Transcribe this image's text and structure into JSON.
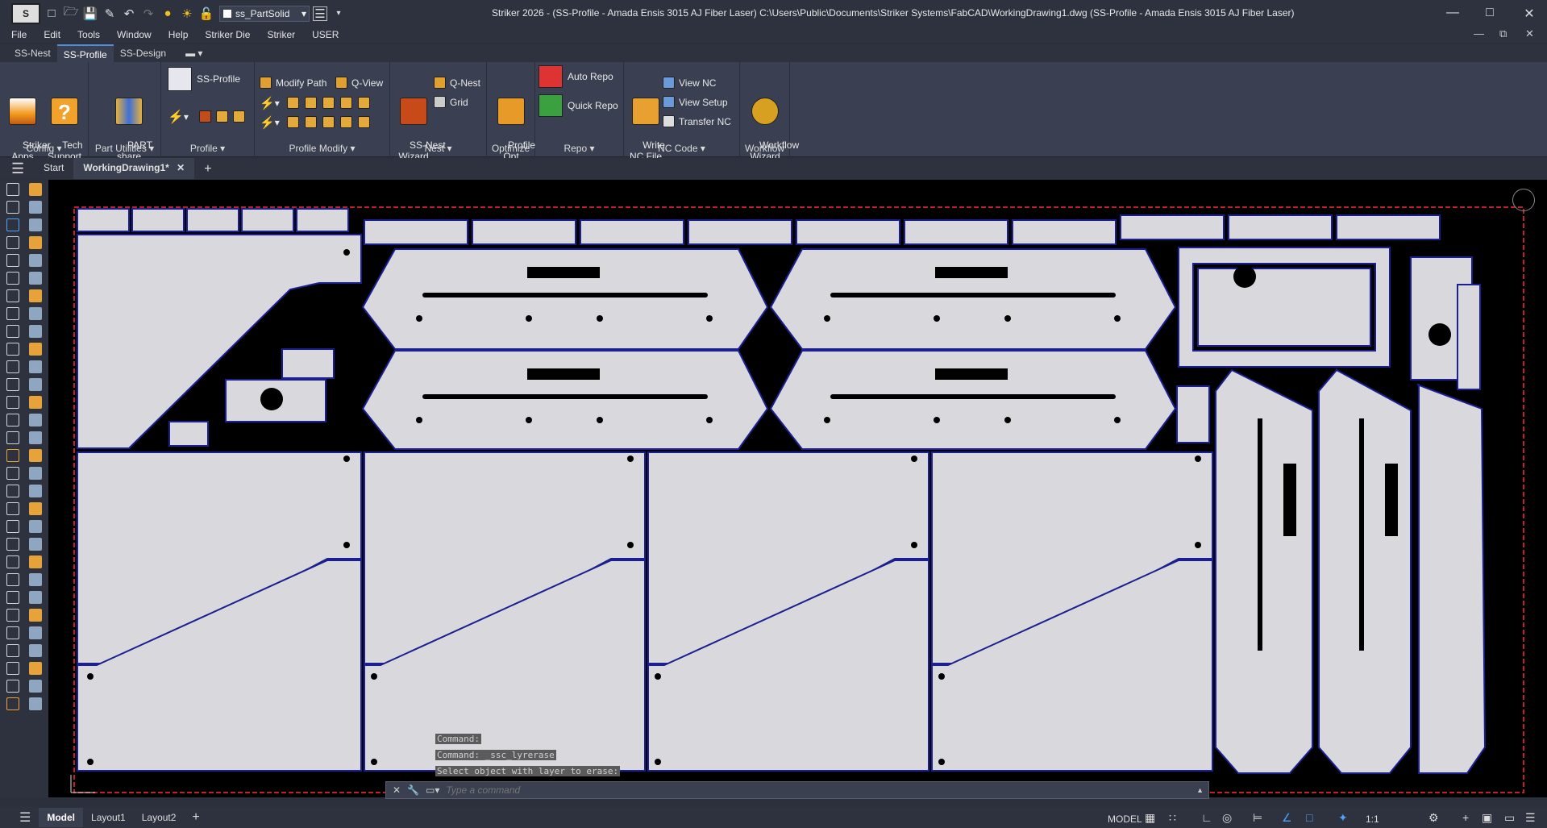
{
  "titlebar": {
    "layer_name": "ss_PartSolid",
    "title": "Striker 2026 -    (SS-Profile - Amada Ensis 3015 AJ Fiber Laser)    C:\\Users\\Public\\Documents\\Striker Systems\\FabCAD\\WorkingDrawing1.dwg   (SS-Profile - Amada Ensis 3015 AJ Fiber Laser)"
  },
  "menubar": [
    "File",
    "Edit",
    "Tools",
    "Window",
    "Help",
    "Striker Die",
    "Striker",
    "USER"
  ],
  "ribbon_tabs": [
    {
      "label": "SS-Nest",
      "active": false
    },
    {
      "label": "SS-Profile",
      "active": true
    },
    {
      "label": "SS-Design",
      "active": false
    }
  ],
  "ribbon": {
    "config": {
      "title": "Config",
      "striker_apps": "Striker\nApps",
      "tech_support": "Tech\nSupport"
    },
    "part_utilities": {
      "title": "Part Utilities",
      "part_share": "PART\nshare"
    },
    "profile": {
      "title": "Profile",
      "ss_profile": "SS-Profile"
    },
    "profile_modify": {
      "title": "Profile Modify",
      "modify_path": "Modify Path",
      "q_view": "Q-View"
    },
    "nest": {
      "title": "Nest",
      "wizard": "SS-Nest\nWizard",
      "q_nest": "Q-Nest",
      "grid": "Grid"
    },
    "optimize": {
      "title": "Optimize",
      "profile_opt": "Profile\nOpt"
    },
    "repo": {
      "title": "Repo",
      "auto_repo": "Auto Repo",
      "quick_repo": "Quick Repo"
    },
    "nc_code": {
      "title": "NC Code",
      "write_nc": "Write\nNC File",
      "view_nc": "View NC",
      "view_setup": "View Setup",
      "transfer_nc": "Transfer NC"
    },
    "workflow": {
      "title": "Workflow",
      "wizard": "Workflow\nWizard"
    }
  },
  "doc_tabs": {
    "start": "Start",
    "active": "WorkingDrawing1*"
  },
  "command": {
    "history": [
      "Command:",
      "Command: _ssc_lyrerase",
      "Select object with layer to erase:"
    ],
    "placeholder": "Type a command"
  },
  "statusbar": {
    "tabs": [
      "Model",
      "Layout1",
      "Layout2"
    ],
    "active_tab": "Model",
    "space": "MODEL",
    "scale": "1:1"
  },
  "colors": {
    "sheet_bg": "#000000",
    "part_fill": "#d9d9dd",
    "part_edge": "#1b1f8f",
    "sheet_border": "#c0202a",
    "chrome": "#2d323e",
    "ribbon": "#3a4051"
  }
}
